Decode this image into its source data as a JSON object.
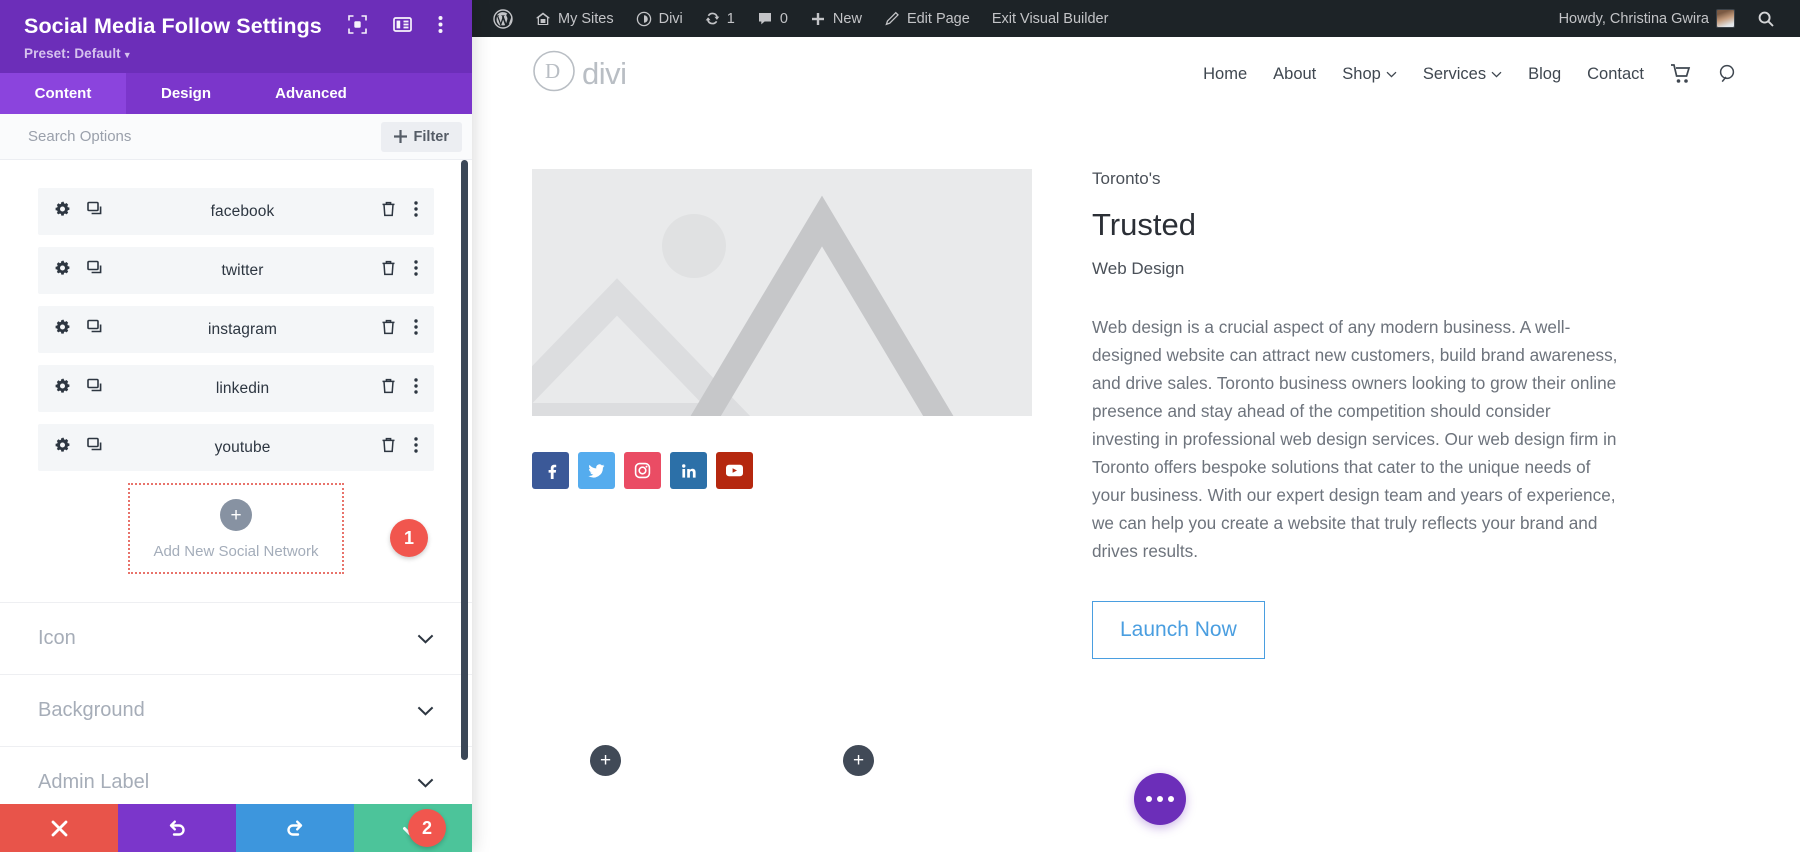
{
  "settings_panel": {
    "title": "Social Media Follow Settings",
    "preset_label": "Preset: Default",
    "header_icons": [
      {
        "name": "focus-target-icon"
      },
      {
        "name": "layout-panel-icon"
      },
      {
        "name": "more-vertical-icon"
      }
    ],
    "tabs": [
      {
        "label": "Content",
        "active": true
      },
      {
        "label": "Design",
        "active": false
      },
      {
        "label": "Advanced",
        "active": false
      }
    ],
    "search": {
      "placeholder": "Search Options",
      "value": ""
    },
    "filter_button": "Filter",
    "social_networks": [
      {
        "label": "facebook"
      },
      {
        "label": "twitter"
      },
      {
        "label": "instagram"
      },
      {
        "label": "linkedin"
      },
      {
        "label": "youtube"
      }
    ],
    "add_network_label": "Add New Social Network",
    "step_badges": [
      {
        "number": "1"
      },
      {
        "number": "2"
      }
    ],
    "collapsible_sections": [
      {
        "label": "Icon"
      },
      {
        "label": "Background"
      },
      {
        "label": "Admin Label"
      }
    ],
    "footer_buttons": [
      {
        "name": "cancel-button",
        "icon": "close-icon",
        "color": "#e8544a"
      },
      {
        "name": "undo-button",
        "icon": "undo-icon",
        "color": "#7b36cb"
      },
      {
        "name": "redo-button",
        "icon": "redo-icon",
        "color": "#3d96dd"
      },
      {
        "name": "save-button",
        "icon": "check-icon",
        "color": "#4cc49a"
      }
    ],
    "colors": {
      "header": "#6c2eb9",
      "tabbar": "#7b36cb",
      "tab_active": "#8b44dd",
      "badge": "#f1564e",
      "dashed_border": "#e8736b"
    }
  },
  "admin_bar": {
    "items": [
      {
        "label": "",
        "icon": "wordpress-logo-icon"
      },
      {
        "label": "My Sites",
        "icon": "sites-icon"
      },
      {
        "label": "Divi",
        "icon": "divi-dashboard-icon"
      },
      {
        "label": "1",
        "icon": "updates-icon"
      },
      {
        "label": "0",
        "icon": "comments-icon"
      },
      {
        "label": "New",
        "icon": "plus-icon"
      },
      {
        "label": "Edit Page",
        "icon": "pencil-icon"
      },
      {
        "label": "Exit Visual Builder",
        "icon": ""
      }
    ],
    "howdy": "Howdy, Christina Gwira",
    "search_icon": "search-icon"
  },
  "site_header": {
    "logo_text": "divi",
    "nav": [
      {
        "label": "Home",
        "has_submenu": false
      },
      {
        "label": "About",
        "has_submenu": false
      },
      {
        "label": "Shop",
        "has_submenu": true
      },
      {
        "label": "Services",
        "has_submenu": true
      },
      {
        "label": "Blog",
        "has_submenu": false
      },
      {
        "label": "Contact",
        "has_submenu": false
      }
    ],
    "cart_icon": "cart-icon",
    "search_icon": "search-icon"
  },
  "content": {
    "eyebrow": "Toronto's",
    "headline": "Trusted",
    "subhead": "Web Design",
    "paragraph": "Web design is a crucial aspect of any modern business. A well-designed website can attract new customers, build brand awareness, and drive sales. Toronto business owners looking to grow their online presence and stay ahead of the competition should consider investing in professional web design services. Our web design firm in Toronto offers bespoke solutions that cater to the unique needs of your business. With our expert design team and years of experience, we can help you create a website that truly reflects your brand and drives results.",
    "cta_label": "Launch Now",
    "social_icons": [
      {
        "name": "facebook-icon",
        "color": "#3b5998"
      },
      {
        "name": "twitter-icon",
        "color": "#55acee"
      },
      {
        "name": "instagram-icon",
        "color": "#ea4c64"
      },
      {
        "name": "linkedin-icon",
        "color": "#2c70a8"
      },
      {
        "name": "youtube-icon",
        "color": "#b5280f"
      }
    ],
    "add_module_buttons": [
      {
        "label": "+"
      },
      {
        "label": "+"
      }
    ],
    "fab": {
      "name": "builder-menu-fab",
      "icon": "more-horizontal-icon"
    }
  }
}
